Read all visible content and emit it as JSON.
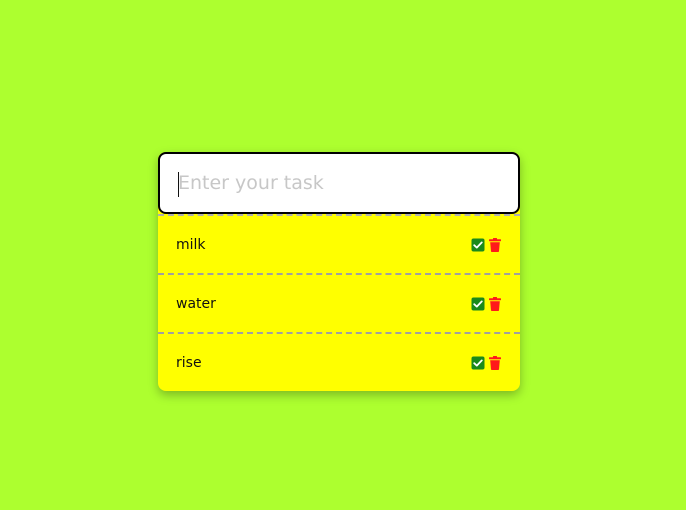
{
  "input": {
    "placeholder": "Enter your task",
    "value": ""
  },
  "tasks": [
    {
      "text": "milk"
    },
    {
      "text": "water"
    },
    {
      "text": "rise"
    }
  ],
  "icons": {
    "check": "check-square-icon",
    "delete": "trash-icon"
  },
  "colors": {
    "background": "#adff2f",
    "list_background": "#ffff00",
    "check": "#1a8a1a",
    "delete": "#ff1a1a"
  }
}
